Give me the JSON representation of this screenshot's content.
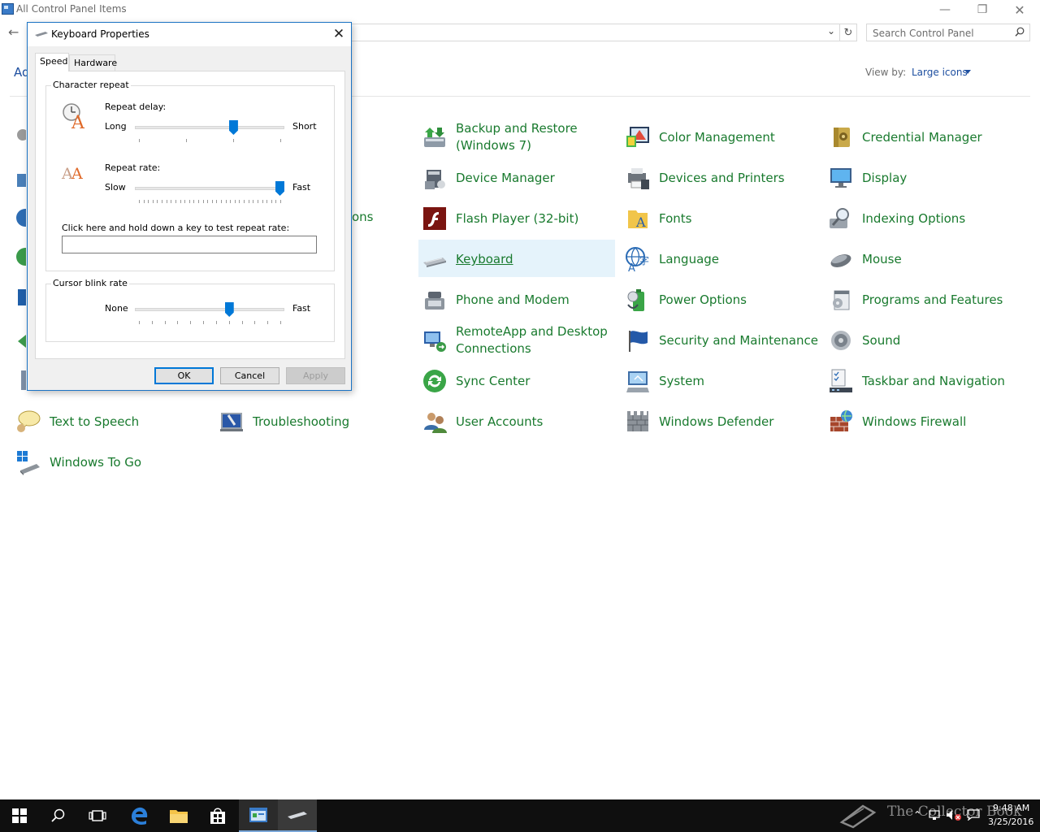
{
  "window": {
    "title": "All Control Panel Items",
    "search_placeholder": "Search Control Panel",
    "adjust_partial": "Ad",
    "view_by_label": "View by:",
    "view_by_value": "Large icons",
    "partial_text": "ons"
  },
  "items": [
    {
      "label_1": "Backup and Restore",
      "label_2": "(Windows 7)"
    },
    {
      "label": "Color Management"
    },
    {
      "label": "Credential Manager"
    },
    {
      "label": "Device Manager"
    },
    {
      "label": "Devices and Printers"
    },
    {
      "label": "Display"
    },
    {
      "label": "Flash Player (32-bit)"
    },
    {
      "label": "Fonts"
    },
    {
      "label": "Indexing Options"
    },
    {
      "label": "Keyboard"
    },
    {
      "label": "Language"
    },
    {
      "label": "Mouse"
    },
    {
      "label": "Phone and Modem"
    },
    {
      "label": "Power Options"
    },
    {
      "label": "Programs and Features"
    },
    {
      "label_1": "RemoteApp and Desktop",
      "label_2": "Connections"
    },
    {
      "label": "Security and Maintenance"
    },
    {
      "label": "Sound"
    },
    {
      "label": "Sync Center"
    },
    {
      "label": "System"
    },
    {
      "label": "Taskbar and Navigation"
    },
    {
      "label": "Text to Speech"
    },
    {
      "label": "Troubleshooting"
    },
    {
      "label": "User Accounts"
    },
    {
      "label": "Windows Defender"
    },
    {
      "label": "Windows Firewall"
    },
    {
      "label": "Windows To Go"
    }
  ],
  "dialog": {
    "title": "Keyboard Properties",
    "tabs": [
      "Speed",
      "Hardware"
    ],
    "character_repeat": {
      "group_title": "Character repeat",
      "repeat_delay_label": "Repeat delay:",
      "delay_min": "Long",
      "delay_max": "Short",
      "delay_value_fraction": 0.67,
      "repeat_rate_label": "Repeat rate:",
      "rate_min": "Slow",
      "rate_max": "Fast",
      "rate_value_fraction": 1.0,
      "test_label": "Click here and hold down a key to test repeat rate:"
    },
    "cursor_blink": {
      "group_title": "Cursor blink rate",
      "min": "None",
      "max": "Fast",
      "value_fraction": 0.64
    },
    "buttons": {
      "ok": "OK",
      "cancel": "Cancel",
      "apply": "Apply"
    }
  },
  "taskbar": {
    "watermark": "The Collector Book",
    "time": "9:48 AM",
    "date": "3/25/2016"
  },
  "colors": {
    "item_text": "#197a2e",
    "link_blue": "#1e4fa0",
    "selection": "#e5f3fb",
    "accent": "#0078d7"
  }
}
